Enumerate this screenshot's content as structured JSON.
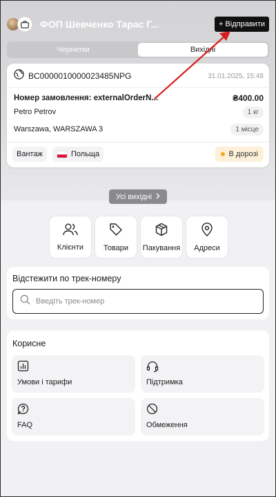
{
  "header": {
    "org_name": "ФОП Шевченко Тарас Г...",
    "send_button": "+ Відправити"
  },
  "tabs": [
    {
      "label": "Чернетки",
      "active": false
    },
    {
      "label": "Вихідні",
      "active": true
    }
  ],
  "shipment": {
    "tracking_number": "BC0000010000023485NPG",
    "date": "31.01.2025, 15:48",
    "order_label": "Номер замовлення: externalOrderN...",
    "price": "₴400.00",
    "recipient": "Petro Petrov",
    "weight": "1 кг",
    "address": "Warszawa, WARSZAWA 3",
    "places": "1 місце",
    "cargo_type": "Вантаж",
    "country": "Польща",
    "status": "В дорозі",
    "status_color": "#f5a623"
  },
  "all_outgoing_button": "Усі вихідні",
  "quick_actions": [
    {
      "label": "Клієнти",
      "icon": "users-icon"
    },
    {
      "label": "Товари",
      "icon": "tag-icon"
    },
    {
      "label": "Пакування",
      "icon": "box-icon"
    },
    {
      "label": "Адреси",
      "icon": "map-pin-icon"
    }
  ],
  "tracking": {
    "title": "Відстежити по трек-номеру",
    "placeholder": "Введіть трек-номер"
  },
  "useful": {
    "title": "Корисне",
    "items": [
      {
        "label": "Умови і тарифи",
        "icon": "chart-bar-icon"
      },
      {
        "label": "Підтримка",
        "icon": "headset-icon"
      },
      {
        "label": "FAQ",
        "icon": "question-icon"
      },
      {
        "label": "Обмеження",
        "icon": "block-icon"
      }
    ]
  },
  "annotation": {
    "arrow_color": "#d81e1e"
  }
}
